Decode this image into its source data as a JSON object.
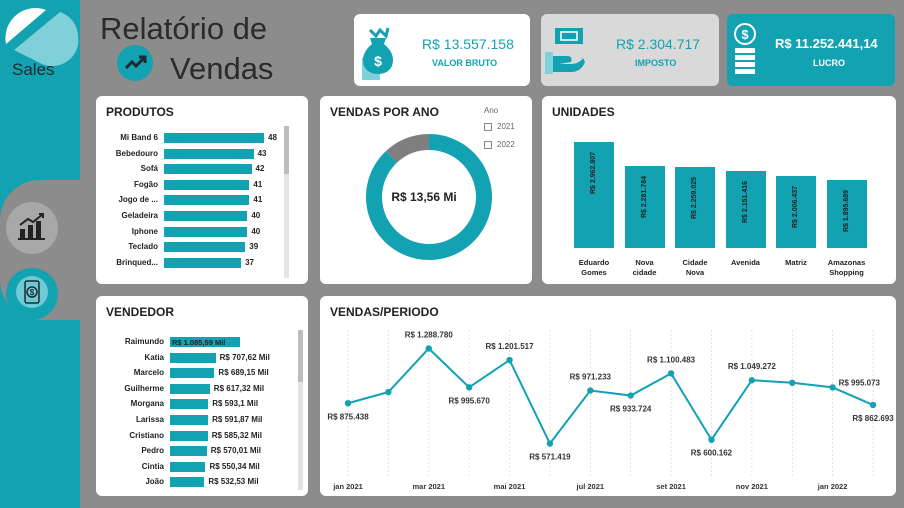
{
  "app": {
    "logo_text": "Sales",
    "title_line1": "Relatório de",
    "title_line2": "Vendas"
  },
  "colors": {
    "accent": "#12a2b2",
    "background": "#8c8c8c",
    "card": "#ffffff",
    "tax_card": "#d9d9d9",
    "donut_other": "#7f7f7f"
  },
  "nav": [
    {
      "icon": "bar-chart-icon"
    },
    {
      "icon": "money-phone-icon"
    }
  ],
  "kpis": [
    {
      "icon": "money-bag-icon",
      "value": "R$ 13.557.158",
      "label": "VALOR BRUTO"
    },
    {
      "icon": "money-hand-icon",
      "value": "R$ 2.304.717",
      "label": "IMPOSTO"
    },
    {
      "icon": "coins-icon",
      "value": "R$ 11.252.441,14",
      "label": "LUCRO"
    }
  ],
  "produtos": {
    "title": "PRODUTOS",
    "chart_data": {
      "type": "bar",
      "orientation": "horizontal",
      "categories": [
        "Mi Band 6",
        "Bebedouro",
        "Sofá",
        "Fogão",
        "Jogo de ...",
        "Geladeira",
        "Iphone",
        "Teclado",
        "Brinqued..."
      ],
      "values": [
        48,
        43,
        42,
        41,
        41,
        40,
        40,
        39,
        37
      ],
      "labels": [
        "48",
        "43",
        "42",
        "41",
        "41",
        "40",
        "40",
        "39",
        "37"
      ],
      "xlim": [
        0,
        48
      ]
    }
  },
  "vendas_ano": {
    "title": "VENDAS POR ANO",
    "center_label": "R$ 13,56 Mi",
    "legend_title": "Ano",
    "chart_data": {
      "type": "pie",
      "donut": true,
      "categories": [
        "2021",
        "2022"
      ],
      "values": [
        88,
        12
      ],
      "colors": [
        "#12a2b2",
        "#7f7f7f"
      ]
    }
  },
  "unidades": {
    "title": "UNIDADES",
    "chart_data": {
      "type": "bar",
      "categories": [
        "Eduardo Gomes",
        "Nova cidade",
        "Cidade Nova",
        "Avenida",
        "Matriz",
        "Amazonas Shopping"
      ],
      "category_lines": [
        [
          "Eduardo",
          "Gomes"
        ],
        [
          "Nova",
          "cidade"
        ],
        [
          "Cidade",
          "Nova"
        ],
        [
          "Avenida"
        ],
        [
          "Matriz"
        ],
        [
          "Amazonas",
          "Shopping"
        ]
      ],
      "values": [
        2962807,
        2281784,
        2259025,
        2151416,
        2006437,
        1895689
      ],
      "labels": [
        "R$ 2.962.807",
        "R$ 2.281.784",
        "R$ 2.259.025",
        "R$ 2.151.416",
        "R$ 2.006.437",
        "R$ 1.895.689"
      ],
      "ylim": [
        0,
        2962807
      ]
    }
  },
  "vendedor": {
    "title": "VENDEDOR",
    "chart_data": {
      "type": "bar",
      "orientation": "horizontal",
      "categories": [
        "Raimundo",
        "Katia",
        "Marcelo",
        "Guilherme",
        "Morgana",
        "Larissa",
        "Cristiano",
        "Pedro",
        "Cintia",
        "João"
      ],
      "values": [
        1085.59,
        707.62,
        689.15,
        617.32,
        593.1,
        591.87,
        585.32,
        570.01,
        550.34,
        532.53
      ],
      "labels": [
        "R$ 1.085,59 Mil",
        "R$ 707,62 Mil",
        "R$ 689,15 Mil",
        "R$ 617,32 Mil",
        "R$ 593,1 Mil",
        "R$ 591,87 Mil",
        "R$ 585,32 Mil",
        "R$ 570,01 Mil",
        "R$ 550,34 Mil",
        "R$ 532,53 Mil"
      ],
      "xlim": [
        0,
        1085.59
      ]
    }
  },
  "vendas_periodo": {
    "title": "VENDAS/PERIODO",
    "chart_data": {
      "type": "line",
      "x": [
        "jan 2021",
        "fev 2021",
        "mar 2021",
        "abr 2021",
        "mai 2021",
        "jun 2021",
        "jul 2021",
        "ago 2021",
        "set 2021",
        "out 2021",
        "nov 2021",
        "dez 2021",
        "jan 2022",
        "fev 2022"
      ],
      "x_tick_labels": [
        "jan 2021",
        "mar 2021",
        "mai 2021",
        "jul 2021",
        "set 2021",
        "nov 2021",
        "jan 2022"
      ],
      "values": [
        875438,
        960000,
        1288780,
        995670,
        1201517,
        571419,
        971233,
        933724,
        1100483,
        600162,
        1049272,
        1030000,
        995073,
        862693
      ],
      "labels": [
        "R$ 875.438",
        null,
        "R$ 1.288.780",
        "R$ 995.670",
        "R$ 1.201.517",
        "R$ 571.419",
        "R$ 971.233",
        "R$ 933.724",
        "R$ 1.100.483",
        "R$ 600.162",
        "R$ 1.049.272",
        null,
        "R$ 995.073",
        "R$ 862.693"
      ],
      "label_pos": [
        "below",
        null,
        "above",
        "below",
        "above",
        "below",
        "above",
        "below",
        "above",
        "below",
        "above",
        null,
        "right",
        "below"
      ],
      "ylim": [
        500000,
        1300000
      ],
      "grid": false
    }
  }
}
